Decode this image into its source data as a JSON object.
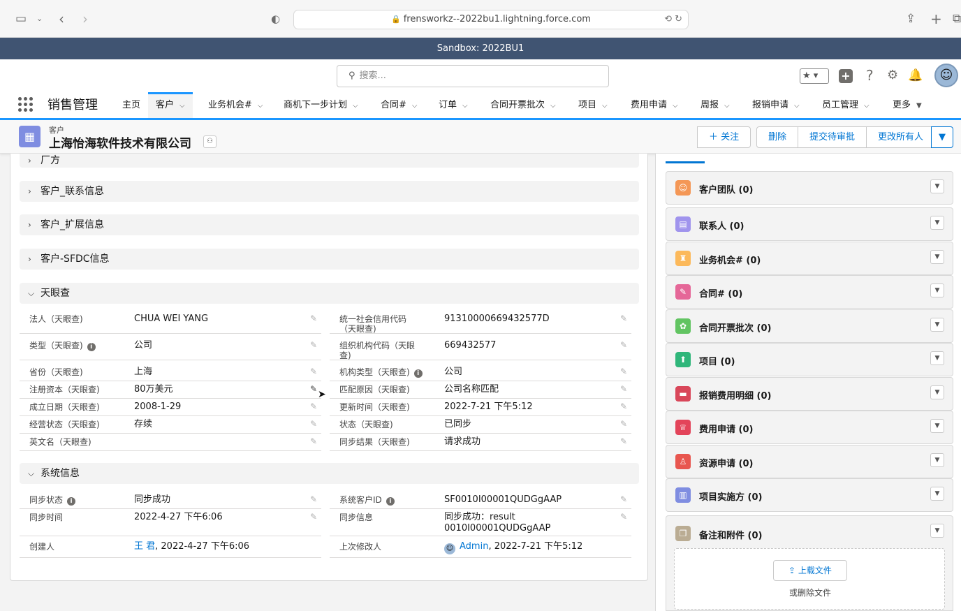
{
  "browser": {
    "url": "frensworkz--2022bu1.lightning.force.com",
    "sandbox_label": "Sandbox: 2022BU1"
  },
  "header": {
    "search_placeholder": "搜索..."
  },
  "nav": {
    "app_name": "销售管理",
    "items": [
      {
        "label": "主页",
        "chevron": false
      },
      {
        "label": "客户",
        "chevron": true,
        "active": true
      },
      {
        "label": "业务机会#",
        "chevron": true
      },
      {
        "label": "商机下一步计划",
        "chevron": true
      },
      {
        "label": "合同#",
        "chevron": true
      },
      {
        "label": "订单",
        "chevron": true
      },
      {
        "label": "合同开票批次",
        "chevron": true
      },
      {
        "label": "项目",
        "chevron": true
      },
      {
        "label": "费用申请",
        "chevron": true
      },
      {
        "label": "周报",
        "chevron": true
      },
      {
        "label": "报销申请",
        "chevron": true
      },
      {
        "label": "员工管理",
        "chevron": true
      },
      {
        "label": "更多",
        "chevron": true
      }
    ]
  },
  "record": {
    "type": "客户",
    "title": "上海怡海软件技术有限公司",
    "buttons": {
      "follow": "关注",
      "delete": "删除",
      "submit": "提交待审批",
      "change_owner": "更改所有人"
    }
  },
  "sections": {
    "partial_top": "厂方",
    "contact": "客户_联系信息",
    "extend": "客户_扩展信息",
    "sfdc": "客户-SFDC信息",
    "tianyancha": "天眼查",
    "system": "系统信息"
  },
  "tianyancha_fields": {
    "left": [
      {
        "label": "法人（天眼查)",
        "value": "CHUA WEI YANG"
      },
      {
        "label": "类型（天眼查)",
        "value": "公司",
        "info": true
      },
      {
        "label": "省份（天眼查)",
        "value": "上海"
      },
      {
        "label": "注册资本（天眼查)",
        "value": "80万美元"
      },
      {
        "label": "成立日期（天眼查)",
        "value": "2008-1-29"
      },
      {
        "label": "经营状态（天眼查)",
        "value": "存续"
      },
      {
        "label": "英文名（天眼查)",
        "value": ""
      }
    ],
    "right": [
      {
        "label": "统一社会信用代码（天眼查)",
        "value": "91310000669432577D"
      },
      {
        "label": "组织机构代码（天眼查)",
        "value": "669432577"
      },
      {
        "label": "机构类型（天眼查)",
        "value": "公司",
        "info": true
      },
      {
        "label": "匹配原因（天眼查)",
        "value": "公司名称匹配"
      },
      {
        "label": "更新时间（天眼查)",
        "value": "2022-7-21 下午5:12"
      },
      {
        "label": "状态（天眼查)",
        "value": "已同步"
      },
      {
        "label": "同步结果（天眼查)",
        "value": "请求成功"
      }
    ]
  },
  "system_fields": {
    "sync_status_label": "同步状态",
    "sync_status_value": "同步成功",
    "sync_time_label": "同步时间",
    "sync_time_value": "2022-4-27 下午6:06",
    "created_by_label": "创建人",
    "created_by_user": "王 君",
    "created_by_date": ", 2022-4-27 下午6:06",
    "system_id_label": "系统客户ID",
    "system_id_value": "SF0010I00001QUDGgAAP",
    "sync_info_label": "同步信息",
    "sync_info_value_line1": "同步成功：result",
    "sync_info_value_line2": "0010I00001QUDGgAAP",
    "modified_by_label": "上次修改人",
    "modified_by_user": "Admin",
    "modified_by_date": ", 2022-7-21 下午5:12"
  },
  "related": {
    "items": [
      {
        "label": "客户团队 (0)",
        "color": "#f49756",
        "glyph": "☺"
      },
      {
        "label": "联系人 (0)",
        "color": "#a094ed",
        "glyph": "▤"
      },
      {
        "label": "业务机会# (0)",
        "color": "#fcb95b",
        "glyph": "♜"
      },
      {
        "label": "合同# (0)",
        "color": "#e56798",
        "glyph": "✎"
      },
      {
        "label": "合同开票批次 (0)",
        "color": "#62c462",
        "glyph": "✿"
      },
      {
        "label": "项目 (0)",
        "color": "#2fb67a",
        "glyph": "⬆"
      },
      {
        "label": "报销费用明细 (0)",
        "color": "#d9475a",
        "glyph": "▬"
      },
      {
        "label": "费用申请 (0)",
        "color": "#e3445a",
        "glyph": "♕"
      },
      {
        "label": "资源申请 (0)",
        "color": "#e8564f",
        "glyph": "♙"
      },
      {
        "label": "项目实施方 (0)",
        "color": "#7f8de1",
        "glyph": "▥"
      },
      {
        "label": "备注和附件 (0)",
        "color": "#baac93",
        "glyph": "❐"
      }
    ],
    "upload_button": "上载文件",
    "upload_hint": "或删除文件"
  }
}
